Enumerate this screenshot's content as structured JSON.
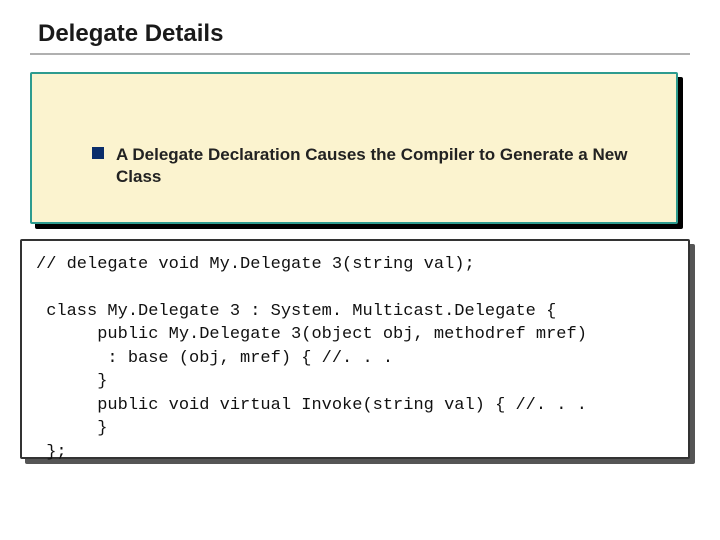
{
  "title": "Delegate Details",
  "bullet": {
    "text": "A Delegate Declaration Causes the Compiler to Generate a New Class"
  },
  "code": {
    "text": "// delegate void My.Delegate 3(string val);\n\n class My.Delegate 3 : System. Multicast.Delegate {\n      public My.Delegate 3(object obj, methodref mref)\n       : base (obj, mref) { //. . .\n      }\n      public void virtual Invoke(string val) { //. . .\n      }\n };"
  }
}
